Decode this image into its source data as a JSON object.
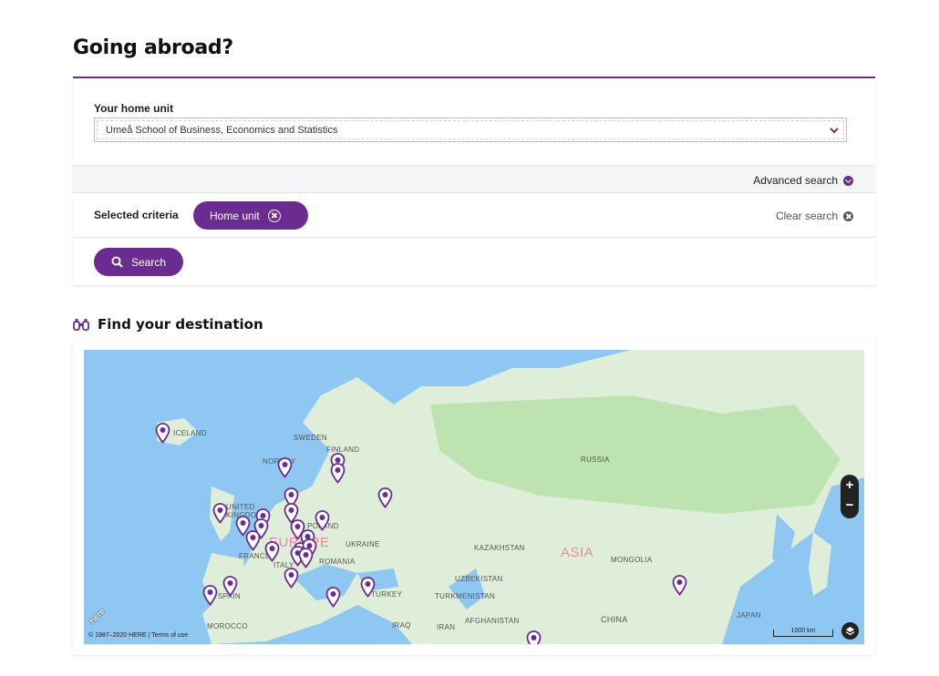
{
  "page": {
    "title": "Going abroad?"
  },
  "search": {
    "home_unit_label": "Your home unit",
    "home_unit_value": "Umeå School of Business, Economics and Statistics",
    "advanced_label": "Advanced search",
    "criteria_label": "Selected criteria",
    "chip_label": "Home unit",
    "clear_label": "Clear search",
    "search_button": "Search"
  },
  "destination": {
    "heading": "Find your destination",
    "map_labels": {
      "iceland": "ICELAND",
      "norway": "NORWAY",
      "sweden": "SWEDEN",
      "finland": "FINLAND",
      "russia": "RUSSIA",
      "united_kingdom": "UNITED KINGDOM",
      "poland": "POLAND",
      "ukraine": "UKRAINE",
      "france": "FRANCE",
      "italy": "ITALY",
      "romania": "ROMANIA",
      "spain": "SPAIN",
      "turkey": "TURKEY",
      "kazakhstan": "KAZAKHSTAN",
      "mongolia": "MONGOLIA",
      "uzbekistan": "UZBEKISTAN",
      "turkmenistan": "TURKMENISTAN",
      "morocco": "MOROCCO",
      "iraq": "IRAQ",
      "iran": "IRAN",
      "afghanistan": "AFGHANISTAN",
      "china": "CHINA",
      "japan": "JAPAN",
      "europe": "EUROPE",
      "asia": "ASIA"
    },
    "zoom_in": "+",
    "zoom_out": "−",
    "copyright": "© 1987–2020 HERE | Terms of use",
    "here_logo": "here",
    "scale_label": "1000 km"
  },
  "colors": {
    "brand": "#6b2c91",
    "water": "#8ec8f2",
    "land": "#dfeed8",
    "forest": "#bde3b0"
  }
}
